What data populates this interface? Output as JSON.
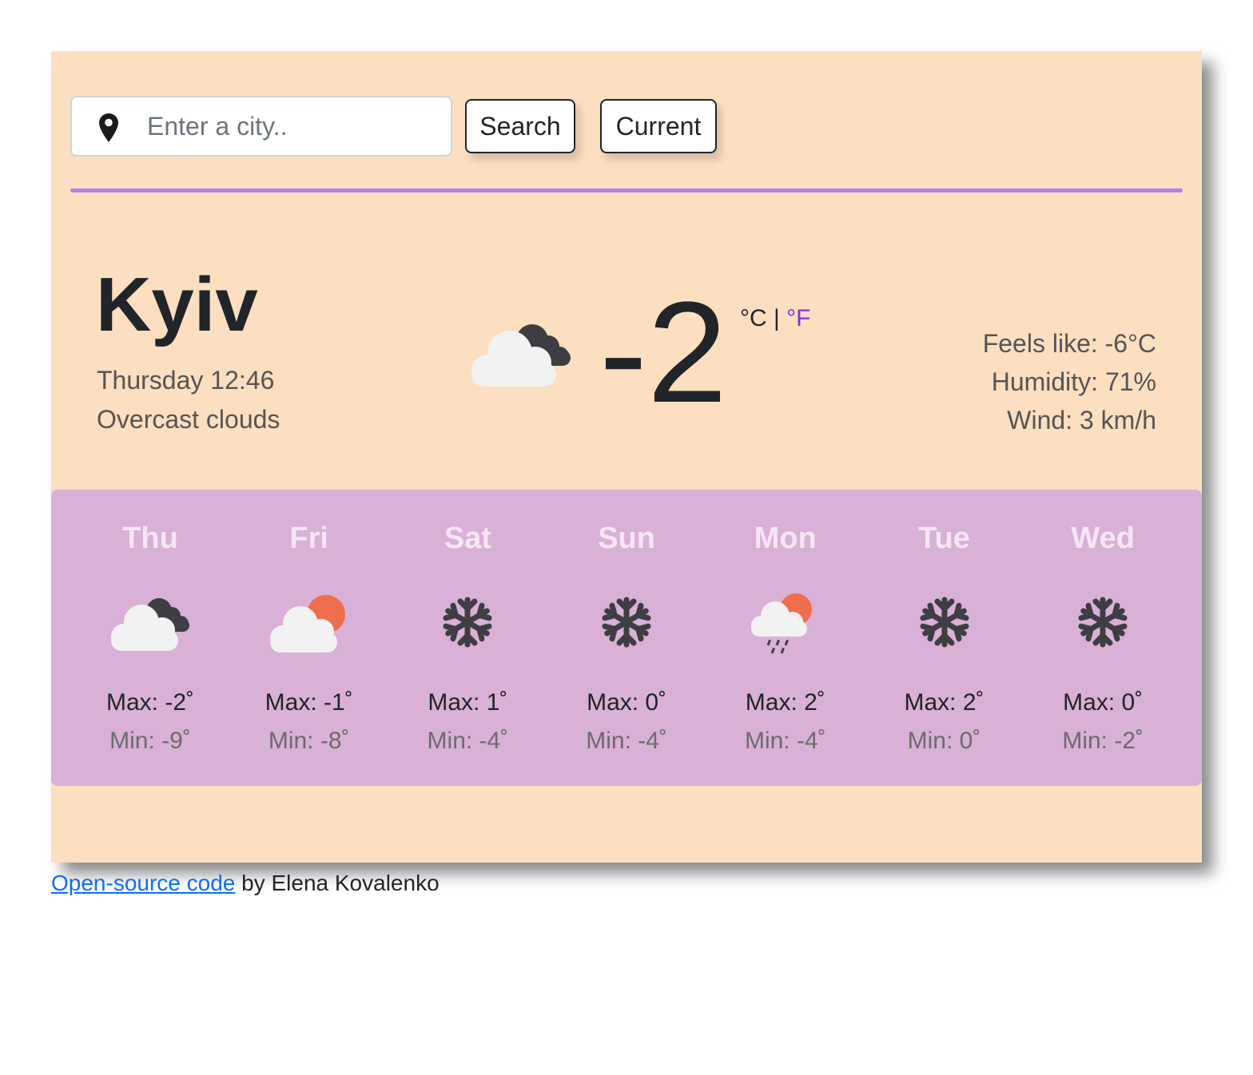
{
  "search": {
    "placeholder": "Enter a city..",
    "search_label": "Search",
    "current_label": "Current"
  },
  "current": {
    "city": "Kyiv",
    "datetime": "Thursday 12:46",
    "condition": "Overcast clouds",
    "temperature": "-2",
    "unit_c": "°C",
    "unit_sep": " | ",
    "unit_f": "°F",
    "icon": "overcast-clouds-icon",
    "feels_like": "Feels like: -6°C",
    "humidity": "Humidity: 71%",
    "wind": "Wind: 3 km/h"
  },
  "forecast": [
    {
      "day": "Thu",
      "max": "Max: -2˚",
      "min": "Min: -9˚",
      "icon": "overcast-clouds-icon"
    },
    {
      "day": "Fri",
      "max": "Max: -1˚",
      "min": "Min: -8˚",
      "icon": "partly-cloudy-icon"
    },
    {
      "day": "Sat",
      "max": "Max: 1˚",
      "min": "Min: -4˚",
      "icon": "snow-icon"
    },
    {
      "day": "Sun",
      "max": "Max: 0˚",
      "min": "Min: -4˚",
      "icon": "snow-icon"
    },
    {
      "day": "Mon",
      "max": "Max: 2˚",
      "min": "Min: -4˚",
      "icon": "rain-sun-icon"
    },
    {
      "day": "Tue",
      "max": "Max: 2˚",
      "min": "Min: 0˚",
      "icon": "snow-icon"
    },
    {
      "day": "Wed",
      "max": "Max: 0˚",
      "min": "Min: -2˚",
      "icon": "snow-icon"
    }
  ],
  "footer": {
    "link_text": "Open-source code",
    "text": " by Elena Kovalenko"
  },
  "colors": {
    "card_bg": "#fcdec0",
    "forecast_bg": "#d9b0d6",
    "divider": "#b57fe7",
    "fahrenheit": "#8a2be2"
  }
}
